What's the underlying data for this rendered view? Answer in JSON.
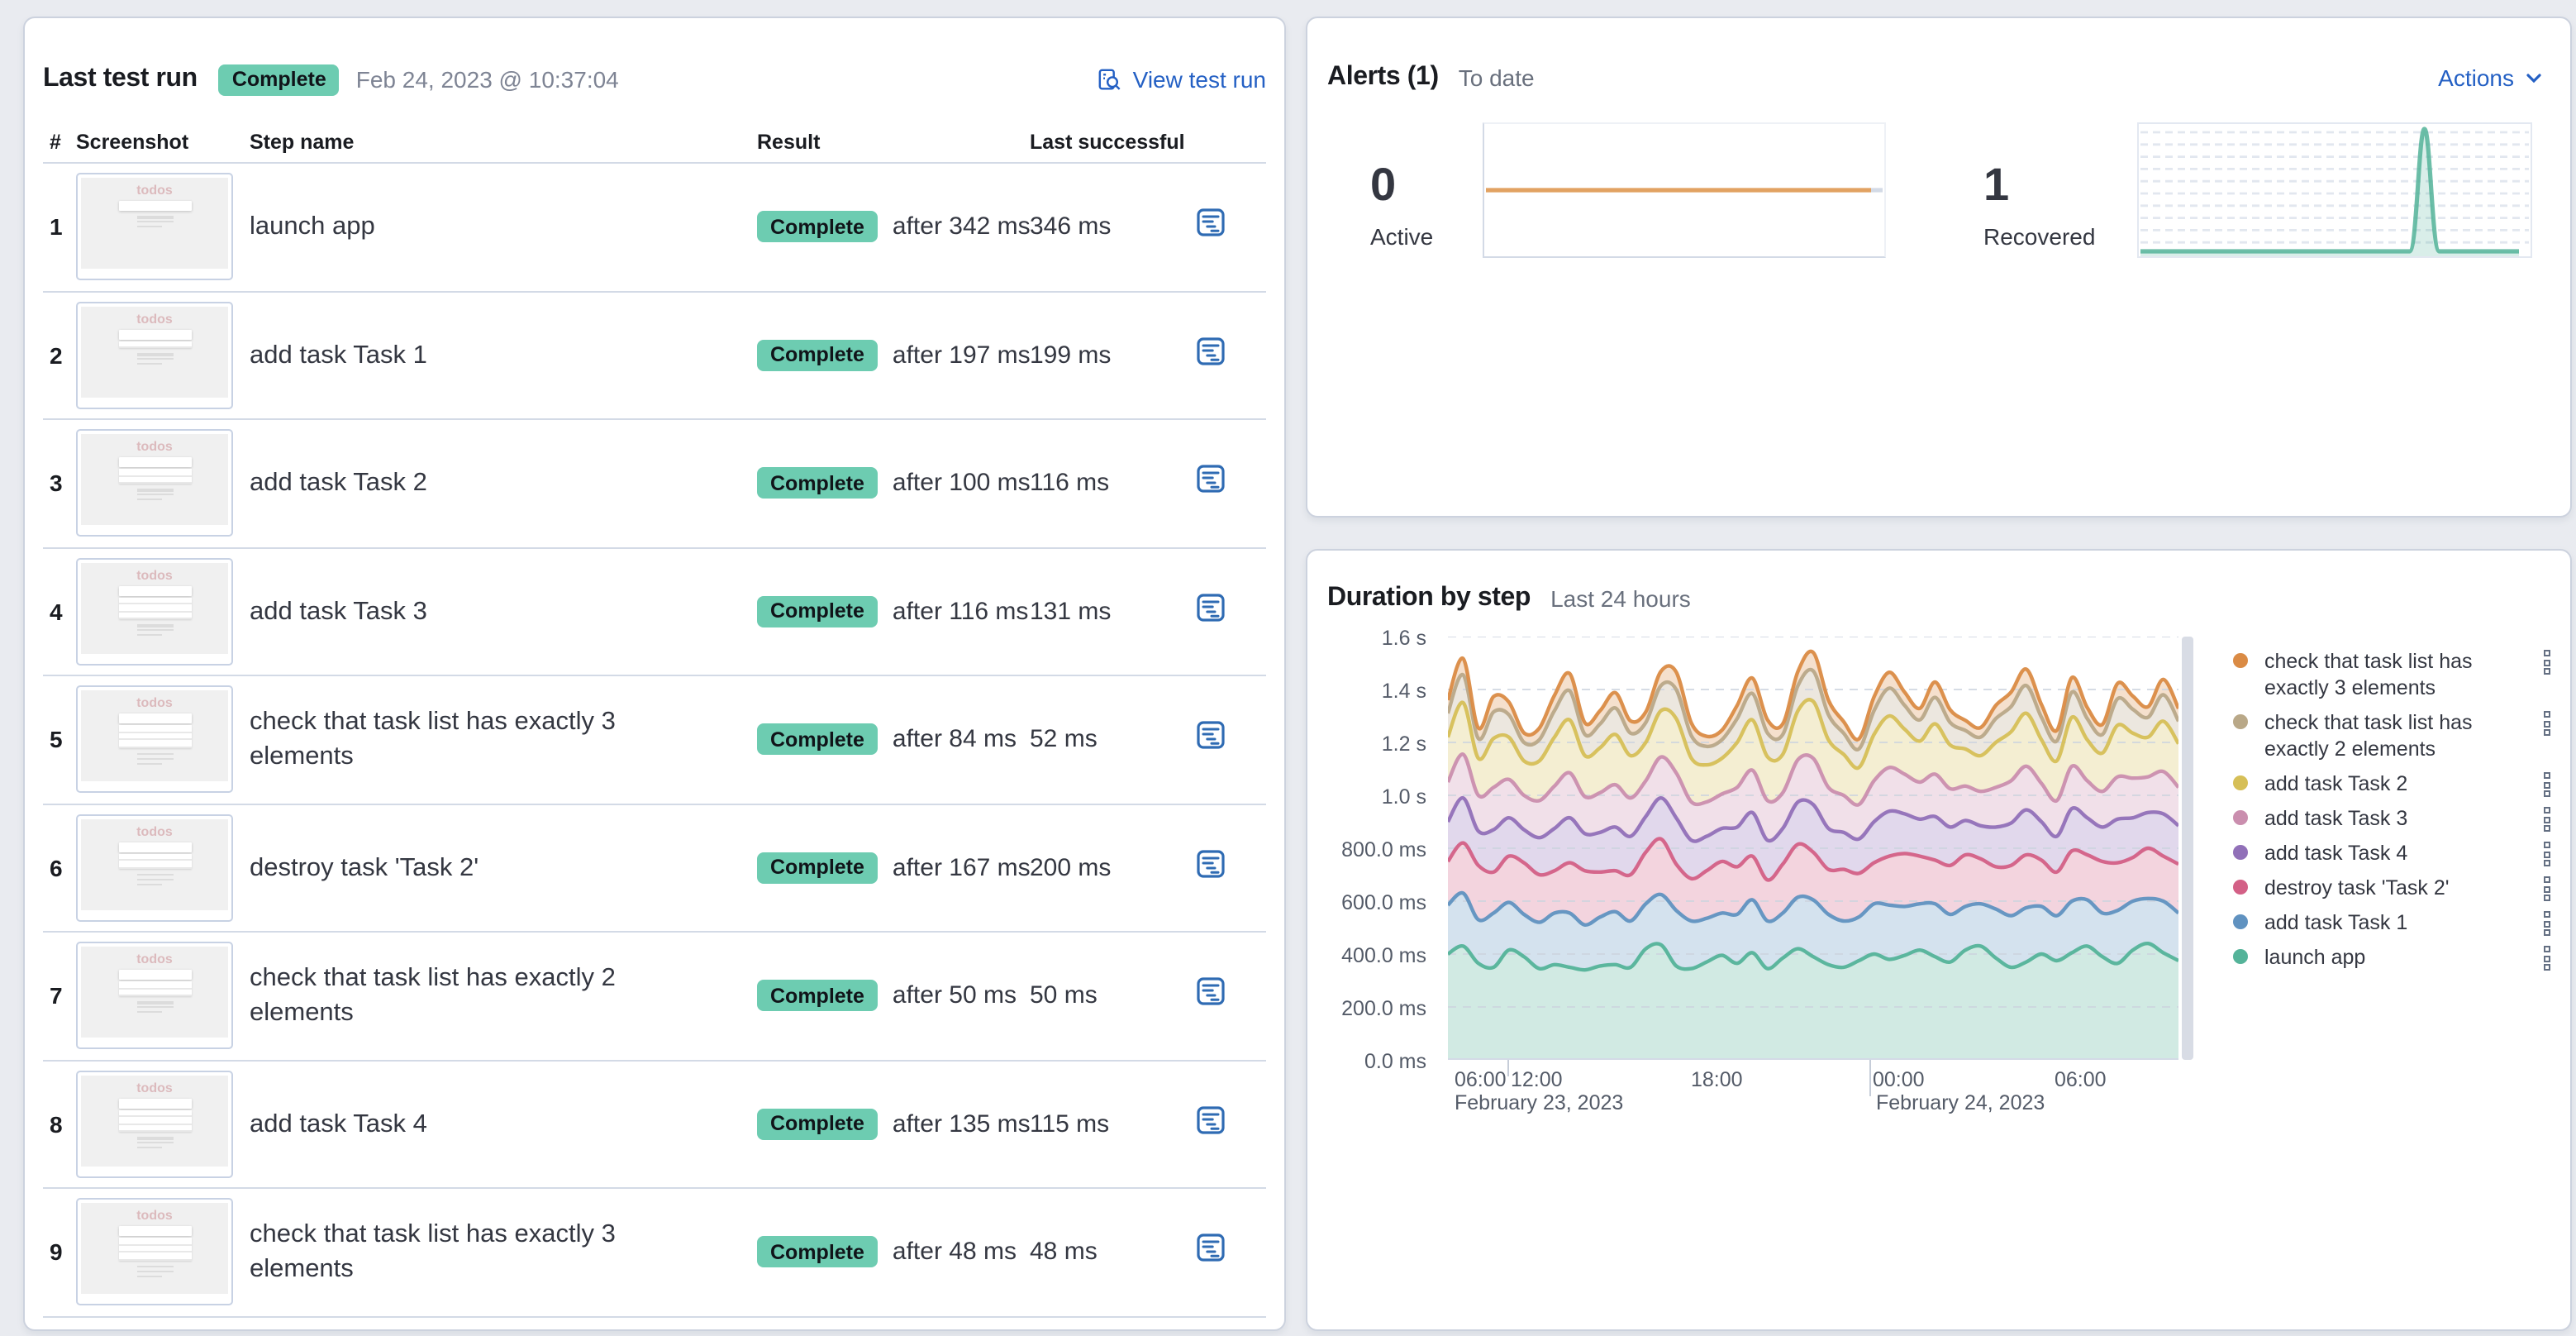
{
  "colors": {
    "badge_green": "#6dccb1",
    "link_blue": "#2460c4",
    "active_line": "#e2a262",
    "recovered_line": "#54b399",
    "page_bg": "#e9ebf0"
  },
  "last_test_run": {
    "title": "Last test run",
    "status_badge": "Complete",
    "timestamp": "Feb 24, 2023 @ 10:37:04",
    "view_link": "View test run",
    "thumbnail_app_title": "todos",
    "table": {
      "headers": {
        "num": "#",
        "screenshot": "Screenshot",
        "step": "Step name",
        "result": "Result",
        "last": "Last successful"
      },
      "rows": [
        {
          "num": "1",
          "step": "launch app",
          "result": "Complete",
          "after": "after 342 ms",
          "last": "346 ms",
          "thumb_lines": 0
        },
        {
          "num": "2",
          "step": "add task Task 1",
          "result": "Complete",
          "after": "after 197 ms",
          "last": "199 ms",
          "thumb_lines": 1
        },
        {
          "num": "3",
          "step": "add task Task 2",
          "result": "Complete",
          "after": "after 100 ms",
          "last": "116 ms",
          "thumb_lines": 2
        },
        {
          "num": "4",
          "step": "add task Task 3",
          "result": "Complete",
          "after": "after 116 ms",
          "last": "131 ms",
          "thumb_lines": 3
        },
        {
          "num": "5",
          "step": "check that task list has exactly 3 elements",
          "result": "Complete",
          "after": "after 84 ms",
          "last": "52 ms",
          "thumb_lines": 3
        },
        {
          "num": "6",
          "step": "destroy task 'Task 2'",
          "result": "Complete",
          "after": "after 167 ms",
          "last": "200 ms",
          "thumb_lines": 2
        },
        {
          "num": "7",
          "step": "check that task list has exactly 2 elements",
          "result": "Complete",
          "after": "after 50 ms",
          "last": "50 ms",
          "thumb_lines": 2
        },
        {
          "num": "8",
          "step": "add task Task 4",
          "result": "Complete",
          "after": "after 135 ms",
          "last": "115 ms",
          "thumb_lines": 3
        },
        {
          "num": "9",
          "step": "check that task list has exactly 3 elements",
          "result": "Complete",
          "after": "after 48 ms",
          "last": "48 ms",
          "thumb_lines": 3
        }
      ]
    }
  },
  "alerts": {
    "title": "Alerts (1)",
    "subtitle": "To date",
    "actions_label": "Actions",
    "stats": [
      {
        "value": "0",
        "label": "Active"
      },
      {
        "value": "1",
        "label": "Recovered"
      }
    ]
  },
  "duration": {
    "title": "Duration by step",
    "subtitle": "Last 24 hours"
  },
  "chart_data": [
    {
      "name": "duration_by_step",
      "type": "area",
      "stacked": true,
      "title": "Duration by step",
      "subtitle": "Last 24 hours",
      "ylabel": "",
      "xlabel": "",
      "y_unit": "ms",
      "ylim": [
        0,
        1600
      ],
      "y_tick_labels": [
        "1.6 s",
        "1.4 s",
        "1.2 s",
        "1.0 s",
        "800.0 ms",
        "600.0 ms",
        "400.0 ms",
        "200.0 ms",
        "0.0 ms"
      ],
      "x_range": [
        "February 23, 2023 06:00",
        "February 24, 2023 06:00"
      ],
      "x_ticks": [
        {
          "label": "06:00",
          "offset": 4,
          "tick": "none"
        },
        {
          "label": "12:00",
          "offset": 38,
          "tick": "short"
        },
        {
          "label": "18:00",
          "offset": 147,
          "tick": "none"
        },
        {
          "label": "00:00",
          "offset": 257,
          "tick": "tall"
        },
        {
          "label": "06:00",
          "offset": 367,
          "tick": "none"
        }
      ],
      "x_date_labels": [
        {
          "label": "February 23, 2023",
          "offset": 4
        },
        {
          "label": "February 24, 2023",
          "offset": 259
        }
      ],
      "grid": "dashed-horizontal",
      "legend_position": "right",
      "series": [
        {
          "name": "launch app",
          "color": "#54B399",
          "values": [
            400,
            430,
            365,
            350,
            415,
            390,
            345,
            360,
            350,
            340,
            355,
            360,
            350,
            420,
            435,
            355,
            345,
            370,
            395,
            365,
            405,
            345,
            385,
            420,
            390,
            360,
            350,
            375,
            400,
            380,
            395,
            415,
            390,
            370,
            415,
            430,
            385,
            350,
            370,
            400,
            375,
            405,
            430,
            390,
            365,
            415,
            440,
            405,
            375
          ]
        },
        {
          "name": "add task Task 1",
          "color": "#6092C0",
          "values": [
            185,
            200,
            165,
            205,
            180,
            160,
            175,
            195,
            205,
            170,
            185,
            200,
            175,
            170,
            190,
            210,
            180,
            165,
            160,
            185,
            200,
            180,
            170,
            195,
            215,
            190,
            175,
            165,
            190,
            205,
            185,
            175,
            200,
            180,
            165,
            160,
            185,
            195,
            205,
            180,
            170,
            195,
            175,
            165,
            200,
            185,
            170,
            195,
            180
          ]
        },
        {
          "name": "destroy task 'Task 2'",
          "color": "#D36086",
          "values": [
            165,
            190,
            205,
            155,
            175,
            195,
            180,
            160,
            190,
            205,
            170,
            155,
            175,
            195,
            210,
            175,
            160,
            180,
            195,
            180,
            165,
            155,
            185,
            200,
            180,
            170,
            195,
            165,
            155,
            185,
            200,
            180,
            165,
            185,
            195,
            170,
            160,
            190,
            200,
            175,
            165,
            190,
            170,
            195,
            180,
            165,
            190,
            170,
            185
          ]
        },
        {
          "name": "add task Task 4",
          "color": "#9170B8",
          "values": [
            150,
            170,
            130,
            160,
            145,
            125,
            140,
            160,
            170,
            140,
            150,
            165,
            145,
            135,
            155,
            175,
            145,
            130,
            125,
            150,
            165,
            150,
            135,
            160,
            180,
            155,
            140,
            130,
            155,
            170,
            150,
            140,
            165,
            145,
            130,
            125,
            150,
            160,
            170,
            145,
            135,
            160,
            140,
            130,
            165,
            150,
            135,
            160,
            145
          ]
        },
        {
          "name": "add task Task 3",
          "color": "#CA8EAE",
          "values": [
            150,
            165,
            135,
            160,
            145,
            130,
            140,
            160,
            170,
            140,
            150,
            160,
            145,
            135,
            155,
            170,
            145,
            130,
            130,
            150,
            160,
            150,
            135,
            160,
            175,
            155,
            140,
            130,
            155,
            165,
            150,
            140,
            160,
            145,
            130,
            130,
            150,
            160,
            165,
            145,
            135,
            160,
            140,
            135,
            160,
            150,
            135,
            160,
            145
          ]
        },
        {
          "name": "add task Task 2",
          "color": "#D6BF57",
          "values": [
            170,
            195,
            140,
            185,
            160,
            130,
            150,
            185,
            200,
            155,
            170,
            190,
            160,
            145,
            175,
            205,
            165,
            140,
            135,
            170,
            190,
            165,
            145,
            185,
            215,
            180,
            155,
            140,
            175,
            195,
            170,
            155,
            190,
            165,
            140,
            135,
            170,
            185,
            200,
            165,
            150,
            185,
            155,
            145,
            195,
            170,
            150,
            190,
            165
          ]
        },
        {
          "name": "check that task list has exactly 2 elements",
          "color": "#B9A888",
          "values": [
            90,
            105,
            75,
            100,
            85,
            70,
            80,
            100,
            110,
            80,
            90,
            100,
            85,
            75,
            95,
            110,
            85,
            70,
            70,
            90,
            100,
            90,
            75,
            95,
            115,
            95,
            80,
            70,
            90,
            105,
            90,
            80,
            100,
            85,
            70,
            70,
            90,
            95,
            105,
            85,
            75,
            95,
            80,
            70,
            100,
            90,
            75,
            100,
            85
          ]
        },
        {
          "name": "check that task list has exactly 3 elements",
          "color": "#DA8B45",
          "values": [
            50,
            62,
            40,
            58,
            48,
            36,
            44,
            58,
            65,
            44,
            50,
            58,
            46,
            40,
            54,
            66,
            48,
            38,
            36,
            50,
            58,
            50,
            40,
            54,
            70,
            55,
            44,
            38,
            52,
            60,
            50,
            44,
            58,
            48,
            38,
            36,
            50,
            55,
            62,
            48,
            40,
            55,
            42,
            38,
            58,
            50,
            40,
            58,
            48
          ]
        }
      ],
      "legend_top_to_bottom": [
        "check that task list has exactly 3 elements",
        "check that task list has exactly 2 elements",
        "add task Task 2",
        "add task Task 3",
        "add task Task 4",
        "destroy task 'Task 2'",
        "add task Task 1",
        "launch app"
      ]
    },
    {
      "name": "alerts_active_sparkline",
      "type": "line",
      "title": "Active",
      "value": 0,
      "color": "#e2a262",
      "values": [
        0,
        0,
        0,
        0,
        0,
        0,
        0,
        0,
        0,
        0,
        0,
        0,
        0,
        0,
        0,
        0,
        0,
        0,
        0,
        0,
        0,
        0,
        0,
        0
      ]
    },
    {
      "name": "alerts_recovered_sparkline",
      "type": "area",
      "title": "Recovered",
      "value": 1,
      "color": "#54b399",
      "grid": "dashed-horizontal",
      "values": [
        0,
        0,
        0,
        0,
        0,
        0,
        0,
        0,
        0,
        0,
        0,
        0,
        0,
        0,
        0,
        0,
        0,
        0,
        0,
        0,
        0,
        0,
        0,
        0,
        1,
        0,
        0,
        0,
        0,
        0,
        0,
        0,
        0
      ]
    }
  ]
}
